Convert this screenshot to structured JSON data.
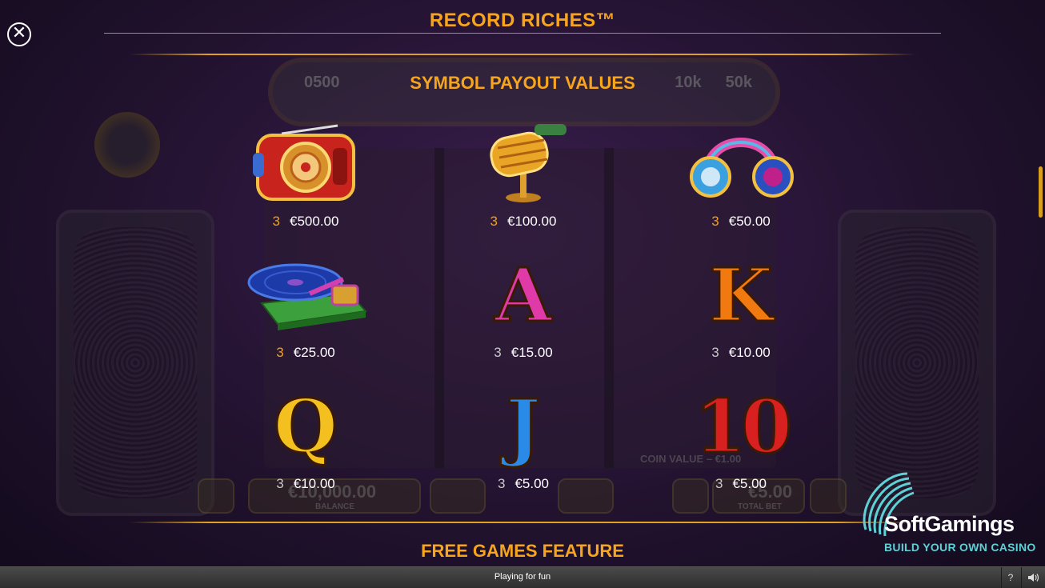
{
  "game": {
    "title": "RECORD RICHES™"
  },
  "paytable": {
    "section_title": "SYMBOL PAYOUT VALUES",
    "symbols": [
      {
        "icon": "radio-icon",
        "count": "3",
        "value": "€500.00"
      },
      {
        "icon": "microphone-icon",
        "count": "3",
        "value": "€100.00"
      },
      {
        "icon": "headphones-icon",
        "count": "3",
        "value": "€50.00"
      },
      {
        "icon": "turntable-icon",
        "count": "3",
        "value": "€25.00"
      },
      {
        "icon": "letter-a-icon",
        "count": "3",
        "value": "€15.00",
        "glyph": "A"
      },
      {
        "icon": "letter-k-icon",
        "count": "3",
        "value": "€10.00",
        "glyph": "K"
      },
      {
        "icon": "letter-q-icon",
        "count": "3",
        "value": "€10.00",
        "glyph": "Q"
      },
      {
        "icon": "letter-j-icon",
        "count": "3",
        "value": "€5.00",
        "glyph": "J"
      },
      {
        "icon": "number-10-icon",
        "count": "3",
        "value": "€5.00",
        "glyph": "10"
      }
    ],
    "next_section_title": "FREE GAMES FEATURE"
  },
  "background": {
    "meter_labels": [
      "0",
      "500",
      "10k",
      "50k"
    ],
    "balance_value": "€10,000.00",
    "balance_label": "BALANCE",
    "coin_value": "COIN VALUE – €1.00",
    "total_bet_value": "€5.00",
    "total_bet_label": "TOTAL BET"
  },
  "branding": {
    "name": "SoftGamings",
    "tagline": "BUILD YOUR OWN CASINO"
  },
  "status_bar": {
    "text": "Playing for fun",
    "help_label": "?",
    "sound_icon": "speaker-icon"
  },
  "colors": {
    "accent": "#f7a51c",
    "count_gold": "#f0a020",
    "brand_teal": "#5ed1d6"
  }
}
